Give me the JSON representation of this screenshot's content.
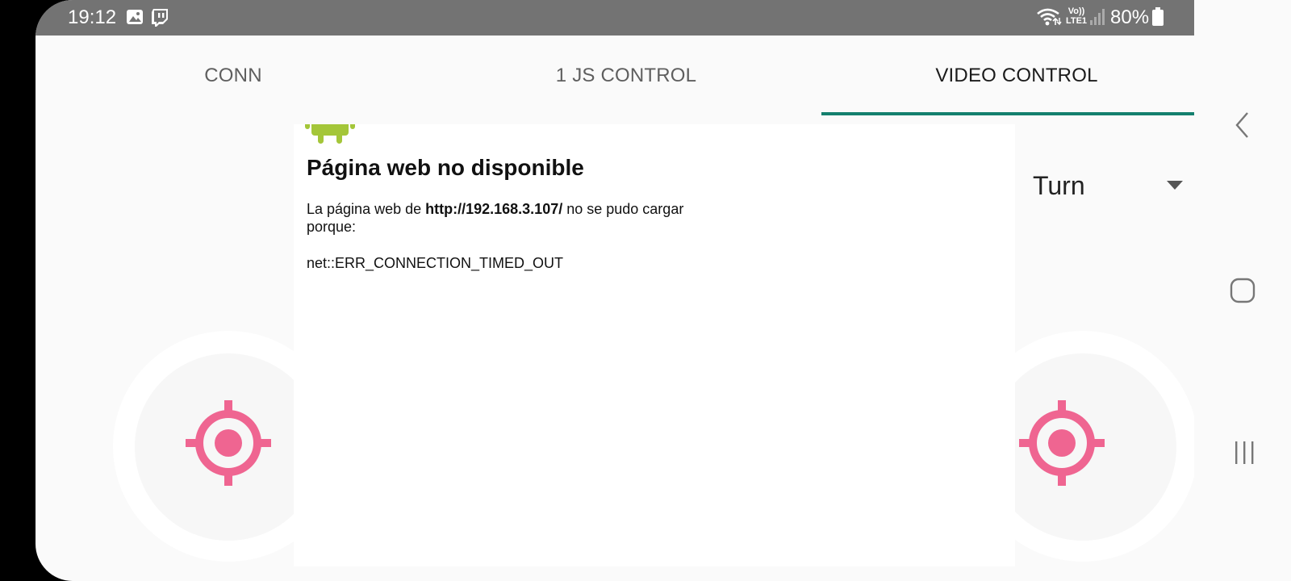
{
  "status_bar": {
    "time": "19:12",
    "battery_percent": "80%",
    "network_label_top": "Vo))",
    "network_label_bottom": "LTE1",
    "icons": [
      "gallery-icon",
      "twitch-icon",
      "wifi-icon",
      "volte-icon",
      "signal-icon",
      "battery-icon"
    ]
  },
  "tabs": [
    {
      "label": "CONN",
      "active": false
    },
    {
      "label": "1 JS CONTROL",
      "active": false
    },
    {
      "label": "VIDEO CONTROL",
      "active": true
    }
  ],
  "webview": {
    "title": "Página web no disponible",
    "body_prefix": "La página web de ",
    "url": "http://192.168.3.107/",
    "body_suffix": " no se pudo cargar porque:",
    "error_code": "net::ERR_CONNECTION_TIMED_OUT"
  },
  "mode_dropdown": {
    "selected": "Turn"
  },
  "joysticks": {
    "knob_color": "#ef6591",
    "count": 2
  },
  "colors": {
    "tab_indicator": "#14806e",
    "status_bar": "#737373",
    "android_green": "#a4c639"
  },
  "nav_bar": {
    "buttons": [
      "back-icon",
      "home-icon",
      "recents-icon"
    ]
  }
}
